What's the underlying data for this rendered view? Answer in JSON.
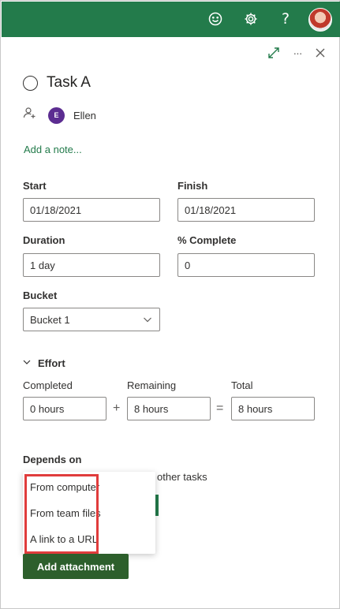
{
  "topbar": {
    "icons": [
      "smiley-icon",
      "gear-icon",
      "help-icon",
      "user-avatar"
    ],
    "help_glyph": "?",
    "accent": "#237b4b"
  },
  "panel": {
    "actions": [
      "expand-icon",
      "more-icon",
      "close-icon"
    ],
    "more_glyph": "···"
  },
  "task": {
    "title": "Task A",
    "assignee_initial": "E",
    "assignee_name": "Ellen",
    "add_note": "Add a note..."
  },
  "dates": {
    "start_label": "Start",
    "start_value": "01/18/2021",
    "finish_label": "Finish",
    "finish_value": "01/18/2021"
  },
  "progress": {
    "duration_label": "Duration",
    "duration_value": "1 day",
    "complete_label": "% Complete",
    "complete_value": "0"
  },
  "bucket": {
    "label": "Bucket",
    "value": "Bucket 1"
  },
  "effort": {
    "title": "Effort",
    "completed_label": "Completed",
    "completed_value": "0 hours",
    "plus": "+",
    "remaining_label": "Remaining",
    "remaining_value": "8 hours",
    "equals": "=",
    "total_label": "Total",
    "total_value": "8 hours"
  },
  "depends": {
    "label": "Depends on",
    "partial_text": "other tasks"
  },
  "attach_menu": {
    "items": [
      "From computer",
      "From team files",
      "A link to a URL"
    ]
  },
  "attachment_button": "Add attachment"
}
